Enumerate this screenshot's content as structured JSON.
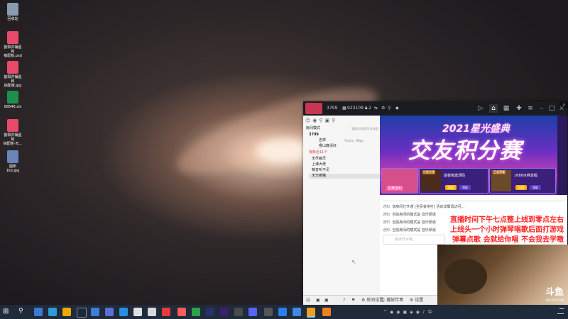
{
  "desktop": {
    "icons": [
      {
        "label": "回收站",
        "color": "#8a9bb0"
      },
      {
        "label": "韵阳并铺盈和\n搞配板.psd",
        "color": "#e84a6a"
      },
      {
        "label": "韵阳并铺盈和\n搞配板.jpg",
        "color": "#e84a6a"
      },
      {
        "label": "68546.xls",
        "color": "#1e8e4e"
      },
      {
        "label": "韵阳并铺盈和\n搞配板-无...",
        "color": "#e84a6a"
      },
      {
        "label": "图新1kb.jpg",
        "color": "#6a86b8"
      }
    ]
  },
  "client": {
    "header": {
      "viewer_count": "3799",
      "room_id": "923109",
      "fans": "2"
    },
    "left_panel": {
      "mode_label": "房间模式",
      "mode_hint": "管理员/房管可以查看",
      "top_count": "3799",
      "user1": "吉祥",
      "user2": "Tianjin_ 96qa",
      "user3": "橙山晚清红",
      "tag_new": "我新近11个",
      "list": [
        "无尽幽灵",
        "上课大佬",
        "静音听不见",
        "天天被猪"
      ]
    },
    "banner": {
      "title_small": "2021星光盛典",
      "title_big": "交友积分赛",
      "cards": [
        {
          "label": "星耀福利",
          "btn1": "",
          "btn2": ""
        },
        {
          "label": "首板板激活码",
          "tag": "小皮大佬",
          "btn1": "同盟",
          "btn2": "领取"
        },
        {
          "label": "1688点券波幅",
          "tag": "王者荣耀",
          "btn1": "同盟",
          "btn2": "领取"
        }
      ]
    },
    "chat": {
      "messages": [
        {
          "prefix": "通知:",
          "text": "该房间已开通 [全民有奖打] 活动详细请访问..."
        },
        {
          "prefix": "通知:",
          "text": "当前房间的模式是 音乐频道"
        },
        {
          "prefix": "通知:",
          "text": "当前房间的模式是 音乐频道"
        },
        {
          "prefix": "通知:",
          "text": "当前房间的模式是 音乐频道"
        }
      ],
      "input_placeholder": "说点什么吧..."
    },
    "bottom": {
      "b1": "房间设置",
      "b2": "播放伴奏",
      "b3": "设置"
    }
  },
  "overlay": {
    "line1": "直播时间下午七点整上线到零点左右",
    "line2": "上线头一个小时弹琴唱歌后面打游戏",
    "line3": "弹幕点歌 会就给你唱  不会我去学嗷"
  },
  "webcam": {
    "logo": "斗鱼",
    "logo_sub": "DOUYU.COM"
  }
}
